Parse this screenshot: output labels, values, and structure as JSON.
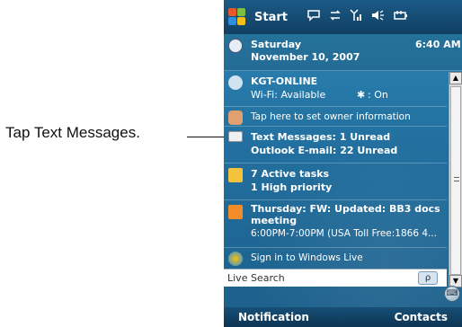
{
  "callout": {
    "label": "Tap Text Messages."
  },
  "titlebar": {
    "start_label": "Start",
    "icons": [
      "speech-bubble-icon",
      "sync-arrows-icon",
      "signal-strength-icon",
      "speaker-icon",
      "battery-plug-icon"
    ]
  },
  "today": {
    "date": {
      "day": "Saturday",
      "date_text": "November 10, 2007",
      "time": "6:40 AM"
    },
    "connection": {
      "name": "KGT-ONLINE",
      "wifi": "Wi-Fi: Available",
      "bluetooth": ": On"
    },
    "owner": {
      "text": "Tap here to set owner information"
    },
    "messages": {
      "line1": "Text Messages: 1 Unread",
      "line2": "Outlook E-mail: 22 Unread"
    },
    "tasks": {
      "line1": "7 Active tasks",
      "line2": "1 High priority"
    },
    "calendar": {
      "line1": "Thursday: FW: Updated: BB3 docs",
      "line2": "meeting",
      "line3": "6:00PM-7:00PM (USA Toll Free:1866 4..."
    },
    "live": {
      "text": "Sign in to Windows Live"
    },
    "live_search": {
      "label": "Live Search",
      "button": "ρ"
    }
  },
  "softkeys": {
    "left": "Notification",
    "right": "Contacts"
  },
  "colors": {
    "screen_top": "#2d87b5",
    "screen_bottom": "#1c5f8a",
    "titlebar": "#113f62"
  }
}
